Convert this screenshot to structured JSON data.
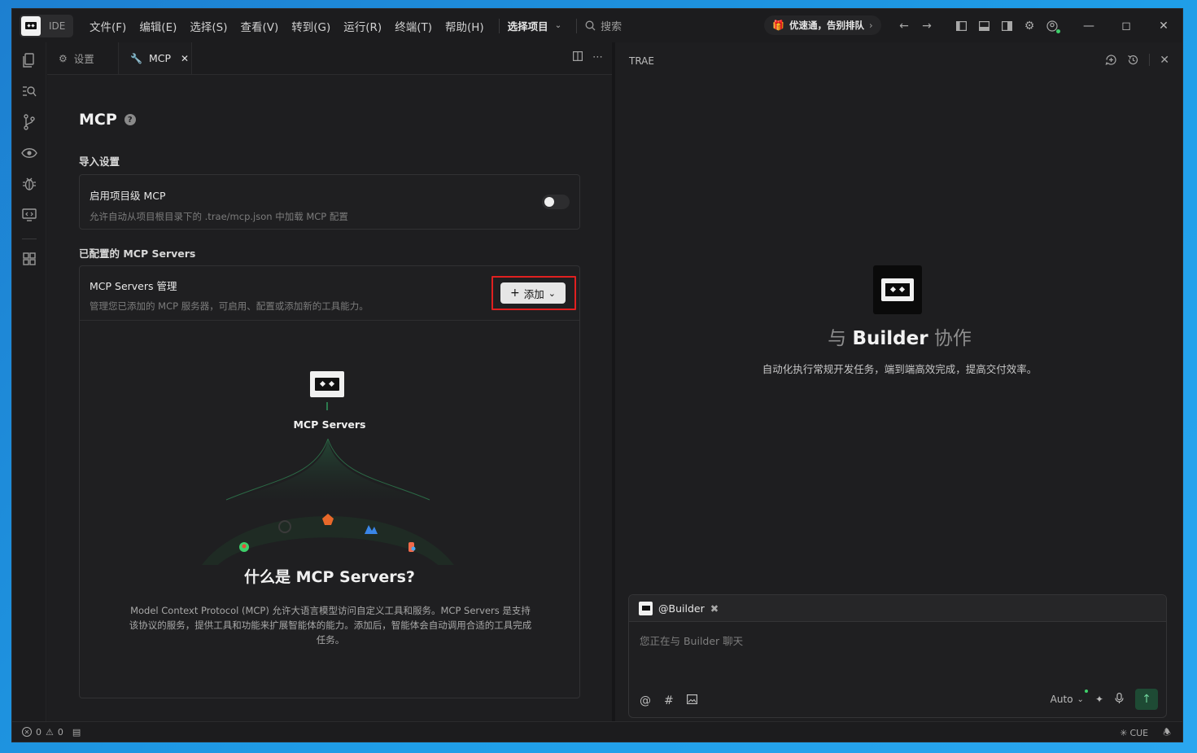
{
  "titlebar": {
    "ide_label": "IDE",
    "menu": [
      "文件(F)",
      "编辑(E)",
      "选择(S)",
      "查看(V)",
      "转到(G)",
      "运行(R)",
      "终端(T)",
      "帮助(H)"
    ],
    "project_select": "选择项目",
    "search_placeholder": "搜索",
    "promo": "优速通，告别排队"
  },
  "editor": {
    "tabs": [
      {
        "label": "设置",
        "icon": "gear-icon",
        "active": false
      },
      {
        "label": "MCP",
        "icon": "wrench-icon",
        "active": true
      }
    ],
    "mcp": {
      "title": "MCP",
      "import_section": "导入设置",
      "project_mcp": {
        "title": "启用项目级 MCP",
        "desc": "允许自动从项目根目录下的 .trae/mcp.json 中加载 MCP 配置",
        "enabled": false
      },
      "configured_section": "已配置的 MCP Servers",
      "servers_card": {
        "title": "MCP Servers 管理",
        "desc": "管理您已添加的 MCP 服务器，可启用、配置或添加新的工具能力。",
        "add_button": "添加"
      },
      "illustration_name": "MCP Servers",
      "what_title": "什么是 MCP Servers?",
      "what_desc": "Model Context Protocol (MCP) 允许大语言模型访问自定义工具和服务。MCP Servers 是支持该协议的服务，提供工具和功能来扩展智能体的能力。添加后，智能体会自动调用合适的工具完成任务。"
    }
  },
  "right_panel": {
    "header": "TRAE",
    "builder_title_prefix": "与",
    "builder_title_name": "Builder",
    "builder_title_suffix": "协作",
    "builder_subtitle": "自动化执行常规开发任务，端到端高效完成，提高交付效率。",
    "chat": {
      "mention": "@Builder",
      "placeholder": "您正在与 Builder 聊天",
      "model": "Auto"
    }
  },
  "statusbar": {
    "errors": "0",
    "warnings": "0",
    "cue": "CUE"
  },
  "colors": {
    "accent_green": "#3ecf6a",
    "highlight_red": "#e02020",
    "background": "#1e1e20"
  }
}
